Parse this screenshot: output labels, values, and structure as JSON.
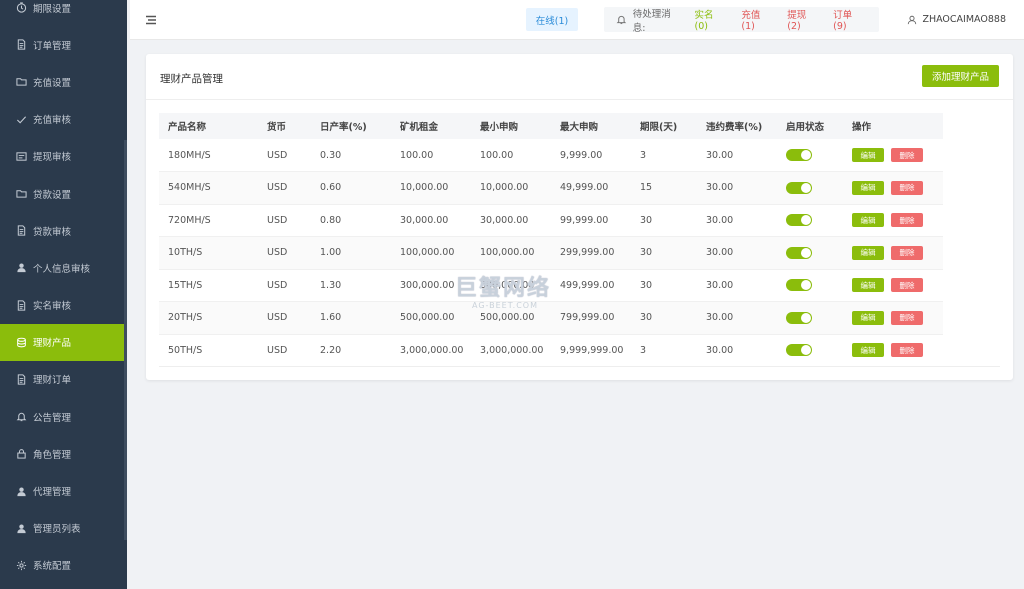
{
  "sidebar": {
    "items": [
      {
        "label": "期限设置",
        "icon": "clock-icon"
      },
      {
        "label": "订单管理",
        "icon": "document-icon"
      },
      {
        "label": "充值设置",
        "icon": "folder-icon"
      },
      {
        "label": "充值审核",
        "icon": "check-icon"
      },
      {
        "label": "提现审核",
        "icon": "card-icon"
      },
      {
        "label": "贷款设置",
        "icon": "folder-icon"
      },
      {
        "label": "贷款审核",
        "icon": "document-icon"
      },
      {
        "label": "个人信息审核",
        "icon": "user-icon"
      },
      {
        "label": "实名审核",
        "icon": "document-icon"
      },
      {
        "label": "理财产品",
        "icon": "database-icon",
        "active": true
      },
      {
        "label": "理财订单",
        "icon": "document-icon"
      },
      {
        "label": "公告管理",
        "icon": "bell-icon"
      },
      {
        "label": "角色管理",
        "icon": "lock-icon"
      },
      {
        "label": "代理管理",
        "icon": "user-icon"
      },
      {
        "label": "管理员列表",
        "icon": "user-icon"
      },
      {
        "label": "系统配置",
        "icon": "gear-icon"
      }
    ]
  },
  "header": {
    "online": "在线(1)",
    "notice_label": "待处理消息:",
    "notices": [
      {
        "label": "实名(0)",
        "color": "green"
      },
      {
        "label": "充值(1)",
        "color": "red"
      },
      {
        "label": "提现(2)",
        "color": "red"
      },
      {
        "label": "订单(9)",
        "color": "red"
      }
    ],
    "username": "ZHAOCAIMAO888"
  },
  "card": {
    "title": "理财产品管理",
    "add_button": "添加理财产品"
  },
  "table": {
    "columns": [
      "产品名称",
      "货币",
      "日产率(%)",
      "矿机租金",
      "最小申购",
      "最大申购",
      "期限(天)",
      "违约费率(%)",
      "启用状态",
      "操作"
    ],
    "edit_label": "编辑",
    "delete_label": "删除",
    "rows": [
      {
        "name": "180MH/S",
        "currency": "USD",
        "rate": "0.30",
        "rent": "100.00",
        "min": "100.00",
        "max": "9,999.00",
        "days": "3",
        "penalty": "30.00",
        "enabled": true
      },
      {
        "name": "540MH/S",
        "currency": "USD",
        "rate": "0.60",
        "rent": "10,000.00",
        "min": "10,000.00",
        "max": "49,999.00",
        "days": "15",
        "penalty": "30.00",
        "enabled": true
      },
      {
        "name": "720MH/S",
        "currency": "USD",
        "rate": "0.80",
        "rent": "30,000.00",
        "min": "30,000.00",
        "max": "99,999.00",
        "days": "30",
        "penalty": "30.00",
        "enabled": true
      },
      {
        "name": "10TH/S",
        "currency": "USD",
        "rate": "1.00",
        "rent": "100,000.00",
        "min": "100,000.00",
        "max": "299,999.00",
        "days": "30",
        "penalty": "30.00",
        "enabled": true
      },
      {
        "name": "15TH/S",
        "currency": "USD",
        "rate": "1.30",
        "rent": "300,000.00",
        "min": "300,000.00",
        "max": "499,999.00",
        "days": "30",
        "penalty": "30.00",
        "enabled": true
      },
      {
        "name": "20TH/S",
        "currency": "USD",
        "rate": "1.60",
        "rent": "500,000.00",
        "min": "500,000.00",
        "max": "799,999.00",
        "days": "30",
        "penalty": "30.00",
        "enabled": true
      },
      {
        "name": "50TH/S",
        "currency": "USD",
        "rate": "2.20",
        "rent": "3,000,000.00",
        "min": "3,000,000.00",
        "max": "9,999,999.00",
        "days": "3",
        "penalty": "30.00",
        "enabled": true
      }
    ]
  },
  "watermark": {
    "main": "巨蟹网络",
    "sub": "AG-BEET.COM"
  },
  "colors": {
    "accent": "#8bbd0c",
    "sidebar": "#2b3a4c",
    "danger": "#ef6b6b",
    "online": "#2a8bd8"
  }
}
